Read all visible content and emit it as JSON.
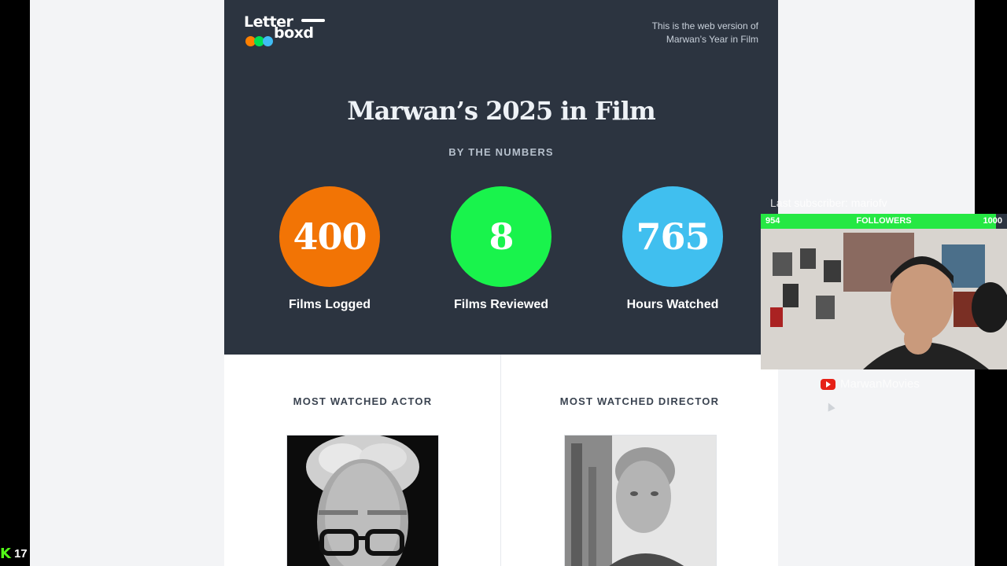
{
  "logo": {
    "line1": "Letter",
    "line2": "boxd",
    "dots": [
      "#ff8000",
      "#00e054",
      "#40bcf4"
    ]
  },
  "header": {
    "web_note_line1": "This is the web version of",
    "web_note_line2": "Marwan’s Year in Film"
  },
  "hero": {
    "title": "Marwan’s 2025 in Film",
    "subtitle": "BY THE NUMBERS",
    "stats": [
      {
        "value": "400",
        "label": "Films Logged",
        "color": "#f27405"
      },
      {
        "value": "8",
        "label": "Films Reviewed",
        "color": "#19f34c"
      },
      {
        "value": "765",
        "label": "Hours Watched",
        "color": "#40bfef"
      }
    ]
  },
  "sections": {
    "actor_heading": "MOST WATCHED ACTOR",
    "director_heading": "MOST WATCHED DIRECTOR"
  },
  "overlay": {
    "followers_current": "954",
    "followers_label": "FOLLOWERS",
    "followers_goal": "1000",
    "followers_progress": 0.954,
    "latest_subscriber": "Last subscriber: mariofv",
    "youtube_channel": "MarwanMovies",
    "kick_count": "17"
  }
}
